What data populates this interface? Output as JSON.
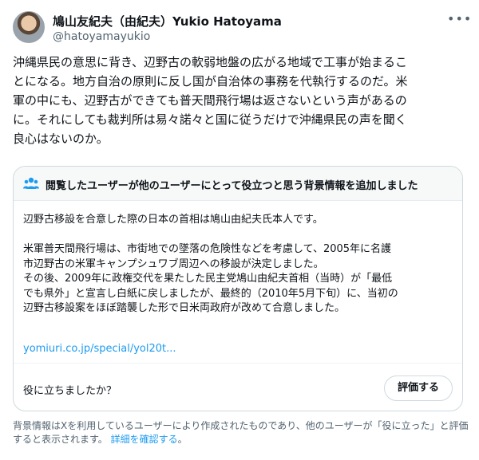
{
  "author": {
    "name": "鳩山友紀夫（由紀夫）Yukio Hatoyama",
    "handle": "@hatoyamayukio",
    "more_icon": "more-horizontal-icon"
  },
  "tweet": {
    "text": "沖縄県民の意思に背き、辺野古の軟弱地盤の広がる地域で工事が始まるこ\nとになる。地方自治の原則に反し国が自治体の事務を代執行するのだ。米\n軍の中にも、辺野古ができても普天間飛行場は返さないという声があるの\nに。それにしても裁判所は易々諾々と国に従うだけで沖縄県民の声を聞く\n良心はないのか。"
  },
  "community_note": {
    "icon": "people-icon",
    "header": "閲覧したユーザーが他のユーザーにとって役立つと思う背景情報を追加しました",
    "body": "辺野古移設を合意した際の日本の首相は鳩山由紀夫氏本人です。\n\n米軍普天間飛行場は、市街地での墜落の危険性などを考慮して、2005年に名護\n市辺野古の米軍キャンプシュワブ周辺への移設が決定しました。\nその後、2009年に政権交代を果たした民主党鳩山由紀夫首相（当時）が「最低\nでも県外」と宣言し白紙に戻しましたが、最終的（2010年5月下旬）に、当初の\n辺野古移設案をほぼ踏襲した形で日米両政府が改めて合意しました。",
    "link": "yomiuri.co.jp/special/yol20t...",
    "helpful_question": "役に立ちましたか？",
    "rate_button": "評価する"
  },
  "footer": {
    "text": "背景情報はXを利用しているユーザーにより作成されたものであり、他のユーザーが「役に立った」と評価すると表示されます。 ",
    "link": "詳細を確認する",
    "end": "。"
  },
  "colors": {
    "link": "#1d9bf0",
    "secondary_text": "#536471",
    "border": "#cfd9de"
  }
}
